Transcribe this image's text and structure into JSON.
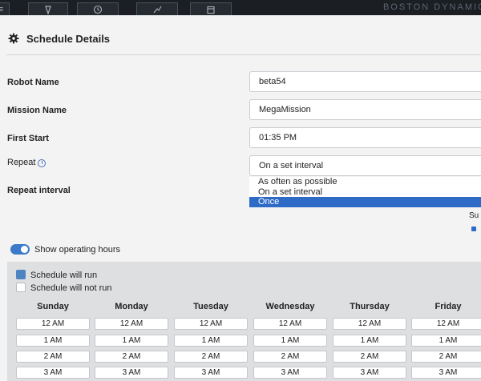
{
  "topbar": {
    "brand": "BOSTON DYNAMIC"
  },
  "header": {
    "title": "Schedule Details"
  },
  "form": {
    "robot_name": {
      "label": "Robot Name",
      "value": "beta54"
    },
    "mission_name": {
      "label": "Mission Name",
      "value": "MegaMission"
    },
    "first_start": {
      "label": "First Start",
      "value": "01:35 PM"
    },
    "repeat": {
      "label": "Repeat",
      "value": "On a set interval",
      "options": [
        "As often as possible",
        "On a set interval",
        "Once"
      ],
      "highlighted": "Once"
    },
    "repeat_interval": {
      "label": "Repeat interval"
    }
  },
  "weekday_partial": {
    "label": "Su"
  },
  "operating_hours": {
    "toggle_label": "Show operating hours",
    "toggle_on": true,
    "legend": {
      "will_run": "Schedule will run",
      "will_not_run": "Schedule will not run"
    },
    "days": [
      "Sunday",
      "Monday",
      "Tuesday",
      "Wednesday",
      "Thursday",
      "Friday"
    ],
    "hours": [
      "12 AM",
      "1 AM",
      "2 AM",
      "3 AM"
    ]
  },
  "colors": {
    "accent": "#2e6bc6",
    "run": "#4f84c2",
    "topbar": "#1b1f24"
  }
}
